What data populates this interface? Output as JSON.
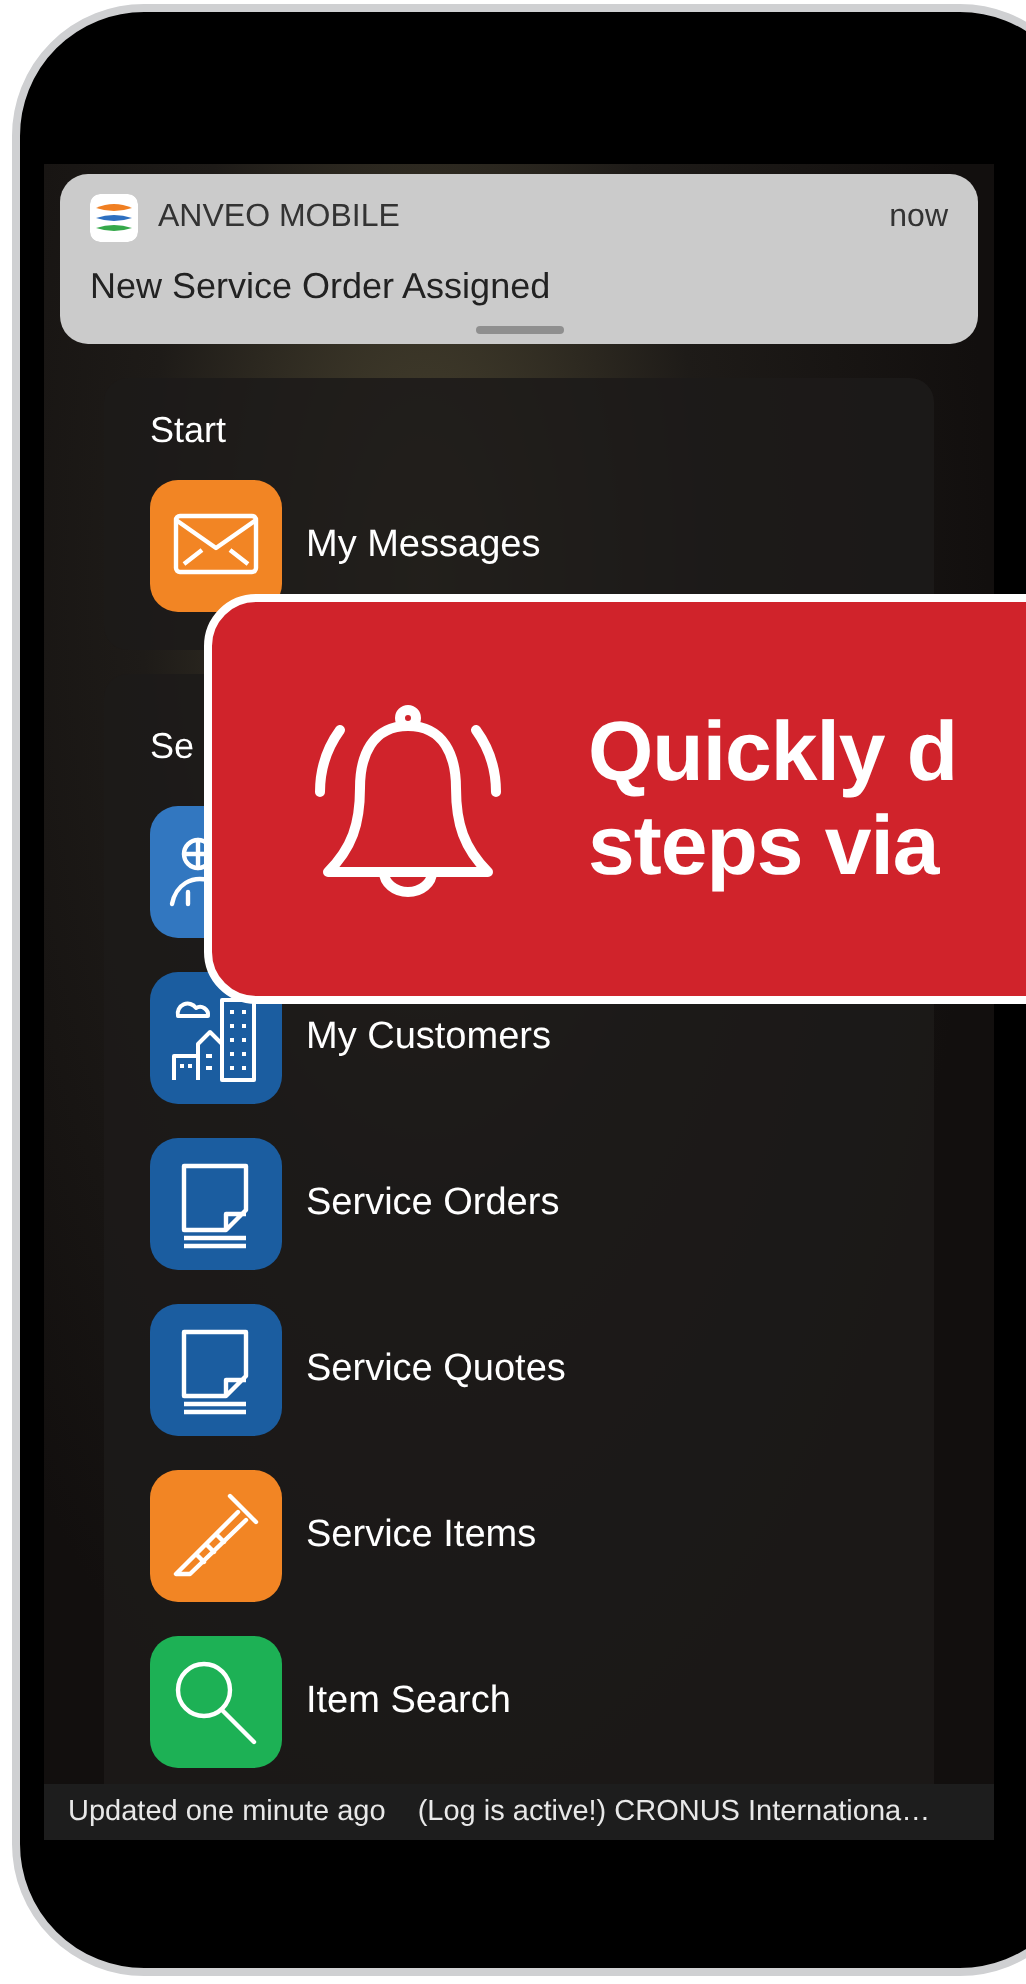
{
  "notification": {
    "app_name": "ANVEO MOBILE",
    "time": "now",
    "message": "New Service Order Assigned"
  },
  "sections": [
    {
      "title": "Start",
      "items": [
        {
          "kind": "envelope",
          "color": "#f28524",
          "label": "My Messages"
        }
      ]
    },
    {
      "title": "Se",
      "items": [
        {
          "kind": "technician",
          "color": "#3277c0"
        },
        {
          "kind": "buildings",
          "color": "#1b5da0",
          "label": "My Customers"
        },
        {
          "kind": "document",
          "color": "#1b5da0",
          "label": "Service Orders"
        },
        {
          "kind": "document",
          "color": "#1b5da0",
          "label": "Service Quotes"
        },
        {
          "kind": "screw",
          "color": "#f28524",
          "label": "Service Items"
        },
        {
          "kind": "search",
          "color": "#1db155",
          "label": "Item Search"
        }
      ]
    }
  ],
  "status_bar": {
    "updated": "Updated one minute ago",
    "info": "(Log is active!) CRONUS Internationa…"
  },
  "callout": {
    "lines": [
      "Quickly d",
      "steps via"
    ]
  }
}
